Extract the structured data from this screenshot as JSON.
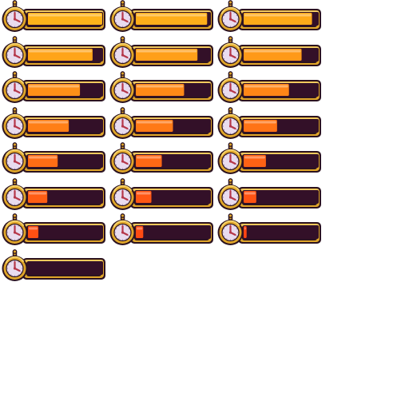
{
  "sprite_sheet": {
    "frame_icon": "stopwatch-icon",
    "colors": {
      "outline": "#2c1320",
      "frame_gold": "#e0a62a",
      "frame_gold_light": "#f6d36a",
      "track_dark": "#331028",
      "clock_face": "#e9dcef",
      "clock_hands": "#b5374a",
      "fill_full": "#ffb31a",
      "fill_empty": "#ff3f12"
    },
    "frames": [
      {
        "fill": 1.0
      },
      {
        "fill": 0.96
      },
      {
        "fill": 0.92
      },
      {
        "fill": 0.87
      },
      {
        "fill": 0.83
      },
      {
        "fill": 0.78
      },
      {
        "fill": 0.7
      },
      {
        "fill": 0.65
      },
      {
        "fill": 0.61
      },
      {
        "fill": 0.55
      },
      {
        "fill": 0.5
      },
      {
        "fill": 0.45
      },
      {
        "fill": 0.4
      },
      {
        "fill": 0.35
      },
      {
        "fill": 0.3
      },
      {
        "fill": 0.26
      },
      {
        "fill": 0.21
      },
      {
        "fill": 0.17
      },
      {
        "fill": 0.14
      },
      {
        "fill": 0.1
      },
      {
        "fill": 0.04
      },
      {
        "fill": 0.0
      }
    ]
  }
}
